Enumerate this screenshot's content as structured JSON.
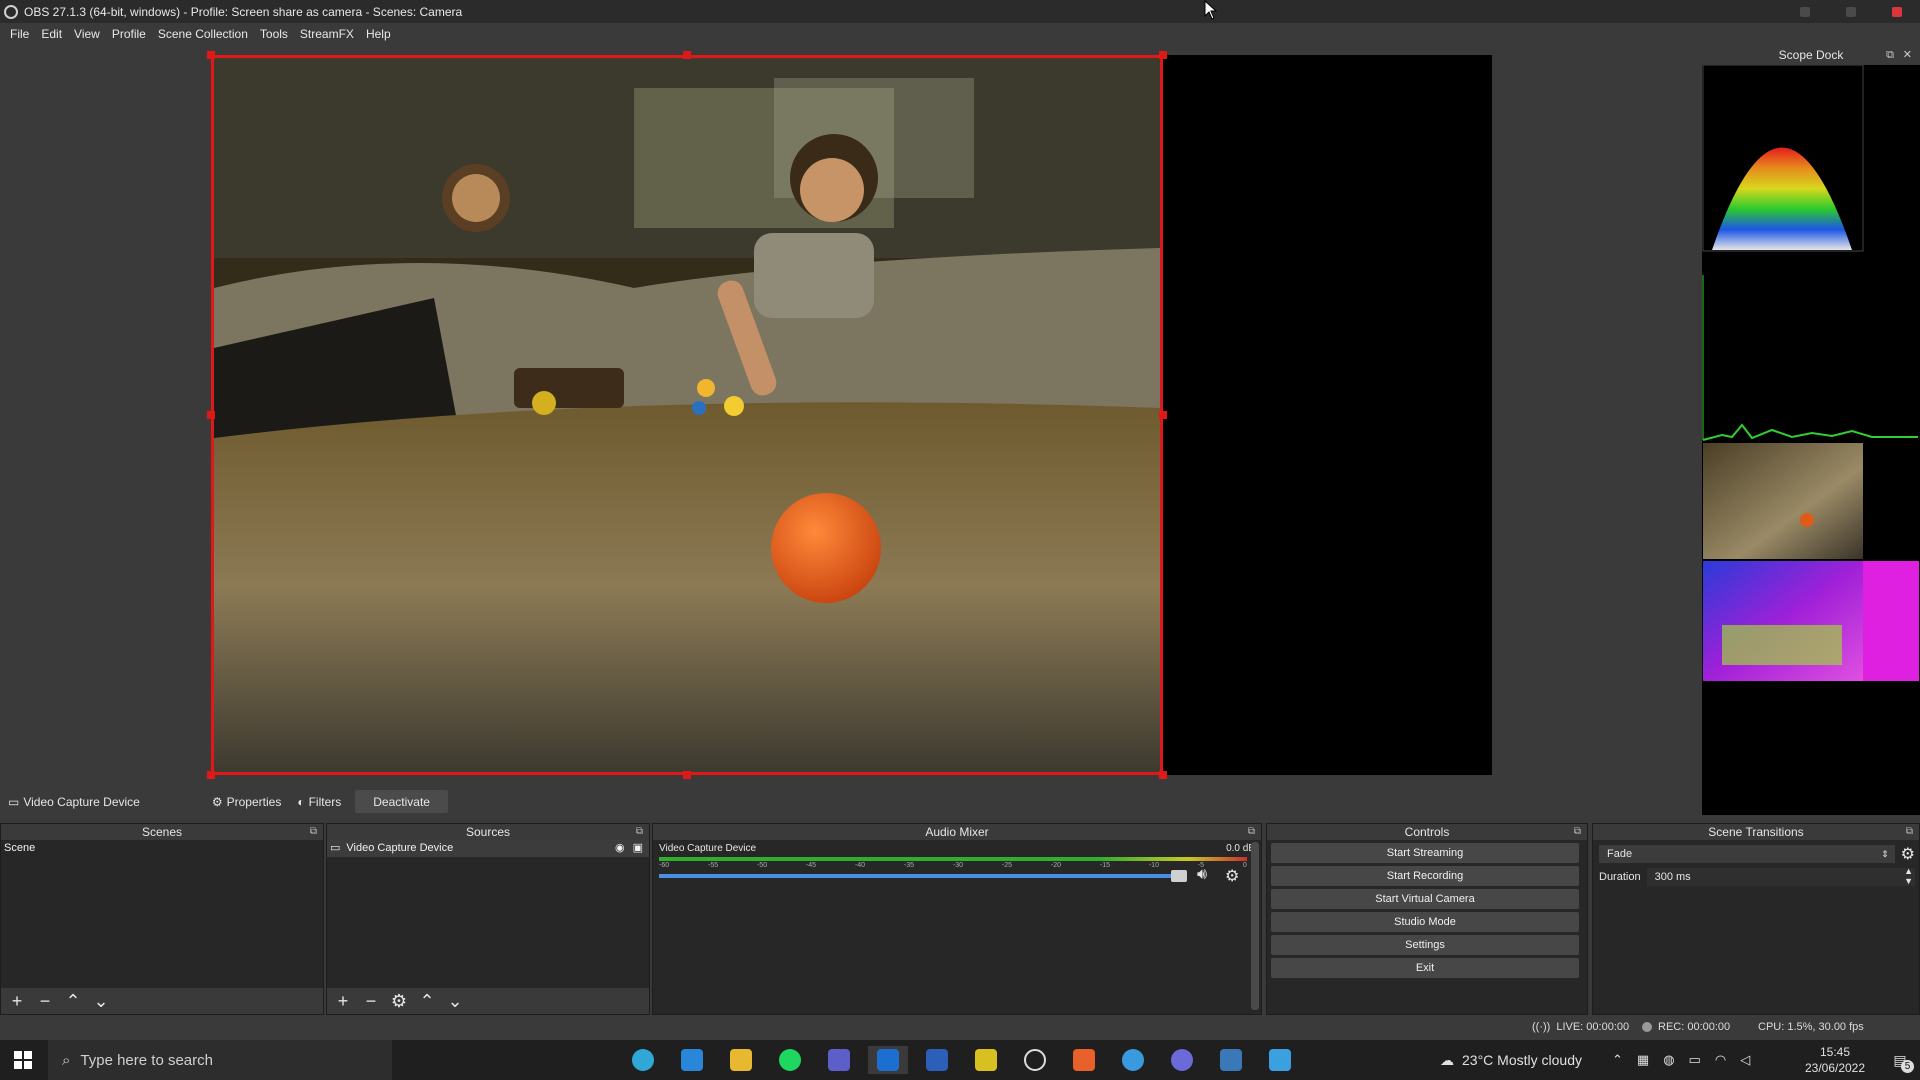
{
  "window": {
    "title": "OBS 27.1.3 (64-bit, windows) - Profile: Screen share as camera - Scenes: Camera"
  },
  "menu": [
    "File",
    "Edit",
    "View",
    "Profile",
    "Scene Collection",
    "Tools",
    "StreamFX",
    "Help"
  ],
  "scope_dock": {
    "title": "Scope Dock"
  },
  "source_toolbar": {
    "source_name": "Video Capture Device",
    "properties": "Properties",
    "filters": "Filters",
    "deactivate": "Deactivate"
  },
  "scenes": {
    "header": "Scenes",
    "items": [
      "Scene"
    ]
  },
  "sources": {
    "header": "Sources",
    "items": [
      "Video Capture Device"
    ]
  },
  "audio_mixer": {
    "header": "Audio Mixer",
    "channel": "Video Capture Device",
    "db": "0.0 dB",
    "ticks": [
      "-60",
      "-55",
      "-50",
      "-45",
      "-40",
      "-35",
      "-30",
      "-25",
      "-20",
      "-15",
      "-10",
      "-5",
      "0"
    ],
    "volume_fraction": 1.0
  },
  "controls": {
    "header": "Controls",
    "buttons": [
      "Start Streaming",
      "Start Recording",
      "Start Virtual Camera",
      "Studio Mode",
      "Settings",
      "Exit"
    ]
  },
  "scene_transitions": {
    "header": "Scene Transitions",
    "transition": "Fade",
    "duration_label": "Duration",
    "duration_value": "300 ms"
  },
  "status": {
    "live": "LIVE: 00:00:00",
    "rec": "REC: 00:00:00",
    "cpu": "CPU: 1.5%, 30.00 fps"
  },
  "taskbar": {
    "search_placeholder": "Type here to search",
    "weather": "23°C  Mostly cloudy",
    "time": "15:45",
    "date": "23/06/2022",
    "notifications": "5"
  },
  "colors": {
    "selection_red": "#e01818",
    "meter_green": "#2fae2f",
    "slider_blue": "#4a90e2"
  }
}
